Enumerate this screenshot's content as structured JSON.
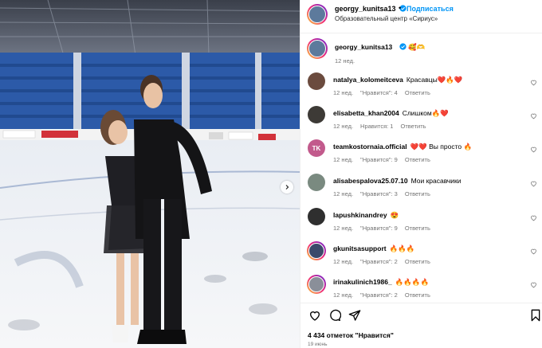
{
  "header": {
    "username": "georgy_kunitsa13",
    "separator": "•",
    "follow_label": "Подписаться",
    "location": "Образовательный центр «Сириус»"
  },
  "caption": {
    "username": "georgy_kunitsa13",
    "emoji": "🥰🫶",
    "time": "12 нед."
  },
  "comments": [
    {
      "username": "natalya_kolomeitceva",
      "text": "Красавцы❤️🔥❤️",
      "time": "12 нед.",
      "likes": "\"Нравится\": 4",
      "reply": "Ответить",
      "avatar_color": "#6b4b3e"
    },
    {
      "username": "elisabetta_khan2004",
      "text": "Слишком🔥❤️",
      "time": "12 нед.",
      "likes": "Нравится: 1",
      "reply": "Ответить",
      "avatar_color": "#3d3a36"
    },
    {
      "username": "teamkostornaia.official",
      "text": "❤️❤️ Вы просто 🔥",
      "time": "12 нед.",
      "likes": "\"Нравится\": 9",
      "reply": "Ответить",
      "avatar_color": "#c25a8c",
      "avatar_text": "TK"
    },
    {
      "username": "alisabespalova25.07.10",
      "text": "Мои красавчики",
      "time": "12 нед.",
      "likes": "\"Нравится\": 3",
      "reply": "Ответить",
      "avatar_color": "#7a8a80"
    },
    {
      "username": "lapushkinandrey",
      "text": "😍",
      "time": "12 нед.",
      "likes": "\"Нравится\": 9",
      "reply": "Ответить",
      "avatar_color": "#2f2f2f"
    },
    {
      "username": "gkunitsasupport",
      "text": "🔥🔥🔥",
      "time": "12 нед.",
      "likes": "\"Нравится\": 2",
      "reply": "Ответить",
      "avatar_color": "#3c4a6b"
    },
    {
      "username": "irinakulinich1986_",
      "text": "🔥🔥🔥🔥",
      "time": "12 нед.",
      "likes": "\"Нравится\": 2",
      "reply": "Ответить",
      "avatar_color": "#8a8f99"
    }
  ],
  "footer": {
    "likes": "4 434 отметок \"Нравится\"",
    "date": "19 июнь"
  },
  "icons": {
    "like": "heart-icon",
    "comment": "comment-icon",
    "share": "share-icon",
    "save": "bookmark-icon",
    "next": "chevron-right-icon",
    "verified": "verified-badge-icon"
  },
  "colors": {
    "accent": "#0095f6",
    "meta": "#737373",
    "heart": "#ed4956"
  }
}
